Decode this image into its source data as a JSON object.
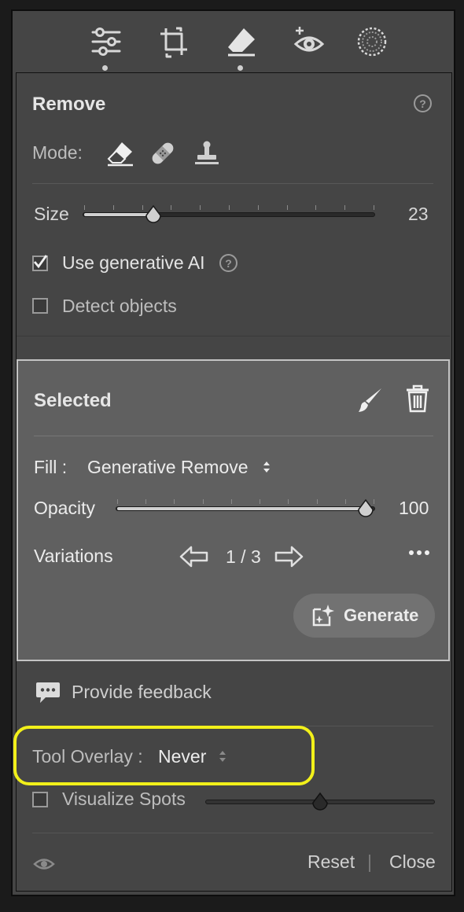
{
  "toolbar": {
    "tools": [
      "edit-sliders-icon",
      "crop-icon",
      "remove-eraser-icon",
      "red-eye-icon",
      "masking-icon"
    ]
  },
  "remove": {
    "title": "Remove",
    "mode_label": "Mode:",
    "mode_icons": [
      "eraser-icon",
      "bandage-icon",
      "clone-stamp-icon"
    ],
    "size_label": "Size",
    "size_value": "23",
    "size_fraction": 0.23,
    "use_gen_ai_label": "Use generative AI",
    "use_gen_ai_checked": true,
    "detect_objects_label": "Detect objects",
    "detect_objects_checked": false
  },
  "selected": {
    "title": "Selected",
    "fill_label": "Fill :",
    "fill_value": "Generative Remove",
    "opacity_label": "Opacity",
    "opacity_value": "100",
    "opacity_fraction": 1.0,
    "variations_label": "Variations",
    "variations_counter": "1 / 3",
    "generate_label": "Generate"
  },
  "feedback": {
    "label": "Provide feedback"
  },
  "overlay": {
    "label": "Tool Overlay :",
    "value": "Never",
    "visualize_label": "Visualize Spots",
    "visualize_checked": false,
    "visualize_fraction": 0.5
  },
  "footer": {
    "reset_label": "Reset",
    "separator": "|",
    "close_label": "Close"
  },
  "colors": {
    "panel_bg": "#454545",
    "selected_bg": "#606060",
    "highlight": "#f2f01a"
  }
}
